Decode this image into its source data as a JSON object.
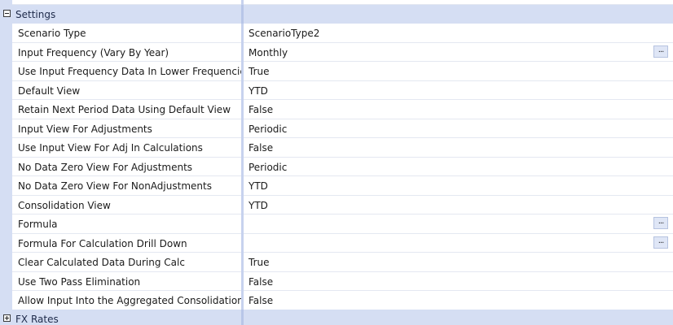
{
  "categories": {
    "settings": {
      "label": "Settings",
      "expanded": true
    },
    "fx_rates": {
      "label": "FX Rates",
      "expanded": false
    }
  },
  "properties": [
    {
      "name": "Scenario Type",
      "value": "ScenarioType2",
      "has_button": false
    },
    {
      "name": "Input Frequency (Vary By Year)",
      "value": "Monthly",
      "has_button": true
    },
    {
      "name": "Use Input Frequency Data In Lower Frequencies",
      "value": "True",
      "has_button": false
    },
    {
      "name": "Default View",
      "value": "YTD",
      "has_button": false
    },
    {
      "name": "Retain Next Period Data Using Default View",
      "value": "False",
      "has_button": false
    },
    {
      "name": "Input View For Adjustments",
      "value": "Periodic",
      "has_button": false
    },
    {
      "name": "Use Input View For Adj In Calculations",
      "value": "False",
      "has_button": false
    },
    {
      "name": "No Data Zero View For Adjustments",
      "value": "Periodic",
      "has_button": false
    },
    {
      "name": "No Data Zero View For NonAdjustments",
      "value": "YTD",
      "has_button": false
    },
    {
      "name": "Consolidation View",
      "value": "YTD",
      "has_button": false
    },
    {
      "name": "Formula",
      "value": "",
      "has_button": true
    },
    {
      "name": "Formula For Calculation Drill Down",
      "value": "",
      "has_button": true
    },
    {
      "name": "Clear Calculated Data During Calc",
      "value": "True",
      "has_button": false
    },
    {
      "name": "Use Two Pass Elimination",
      "value": "False",
      "has_button": false
    },
    {
      "name": "Allow Input Into the Aggregated Consolidation Member",
      "value": "False",
      "has_button": false
    }
  ],
  "ellipsis_label": "...",
  "colors": {
    "category_bg": "#d5def3",
    "divider": "#c7d2ee",
    "row_border": "#e4e8f1",
    "button_bg": "#dfe6f6"
  }
}
